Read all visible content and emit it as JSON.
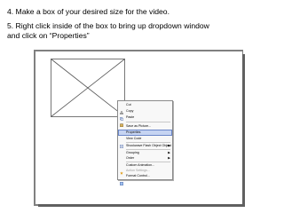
{
  "instructions": {
    "step4": "4. Make a box of your desired size for the video.",
    "step5_line1": "5. Right click inside of the box to bring up dropdown window",
    "step5_line2": "and click on “Properties”"
  },
  "context_menu": {
    "items": [
      {
        "label": "Cut",
        "icon": "scissors-icon"
      },
      {
        "label": "Copy",
        "icon": "copy-icon"
      },
      {
        "label": "Paste",
        "icon": "paste-icon"
      },
      {
        "label": "Save as Picture...",
        "icon": ""
      },
      {
        "label": "Properties",
        "icon": "",
        "highlighted": true
      },
      {
        "label": "View Code",
        "icon": "view-code-icon"
      },
      {
        "label": "Shockwave Flash Object Object",
        "icon": "",
        "submenu": true
      },
      {
        "label": "Grouping",
        "icon": "",
        "submenu": true
      },
      {
        "label": "Order",
        "icon": "",
        "submenu": true
      },
      {
        "label": "Custom Animation...",
        "icon": "custom-animation-icon"
      },
      {
        "label": "Action Settings...",
        "icon": "",
        "disabled": true
      },
      {
        "label": "Format Control...",
        "icon": "format-control-icon"
      }
    ]
  },
  "colors": {
    "menu_highlight": "#c6d4f2",
    "slide_border": "#808080"
  }
}
